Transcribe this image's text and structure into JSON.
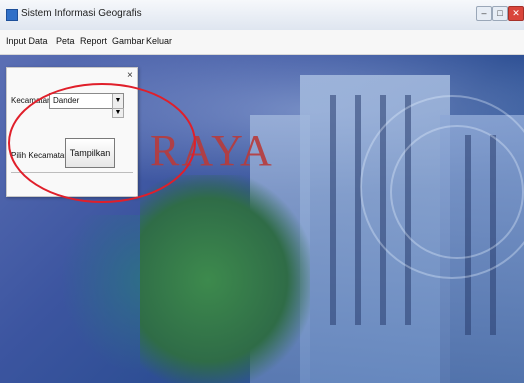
{
  "window": {
    "title": "Sistem Informasi Geografis",
    "min_glyph": "–",
    "max_glyph": "□",
    "close_glyph": "✕"
  },
  "menu": {
    "items": [
      "Input Data",
      "Peta",
      "Report",
      "Gambar",
      "Keluar"
    ]
  },
  "panel": {
    "close_glyph": "×",
    "field_label": "Kecamatan",
    "select_value": "Dander",
    "status_label": "Pilih Kecamatan",
    "button_label": "Tampilkan"
  },
  "background": {
    "logo_text": "RAYA"
  },
  "colors": {
    "annotation": "#e01f2a"
  }
}
